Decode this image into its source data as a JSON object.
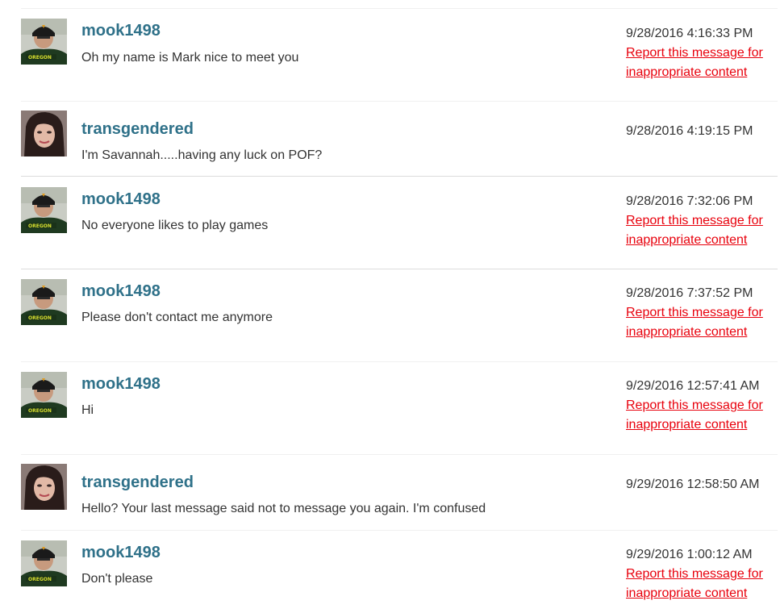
{
  "messages": [
    {
      "user": "mook1498",
      "avatar": "male-avatar",
      "text": "Oh my name is Mark nice to meet you",
      "time": "9/28/2016 4:16:33 PM",
      "report": "Report this message for inappropriate content"
    },
    {
      "user": "transgendered",
      "avatar": "female-avatar",
      "text": "I'm Savannah.....having any luck on POF?",
      "time": "9/28/2016 4:19:15 PM",
      "report": null
    },
    {
      "user": "mook1498",
      "avatar": "male-avatar",
      "text": "No everyone likes to play games",
      "time": "9/28/2016 7:32:06 PM",
      "report": "Report this message for inappropriate content"
    },
    {
      "user": "mook1498",
      "avatar": "male-avatar",
      "text": "Please don't contact me anymore",
      "time": "9/28/2016 7:37:52 PM",
      "report": "Report this message for inappropriate content"
    },
    {
      "user": "mook1498",
      "avatar": "male-avatar",
      "text": "Hi",
      "time": "9/29/2016 12:57:41 AM",
      "report": "Report this message for inappropriate content"
    },
    {
      "user": "transgendered",
      "avatar": "female-avatar",
      "text": "Hello? Your last message said not to message you again. I'm confused",
      "time": "9/29/2016 12:58:50 AM",
      "report": null
    },
    {
      "user": "mook1498",
      "avatar": "male-avatar",
      "text": "Don't please",
      "time": "9/29/2016 1:00:12 AM",
      "report": "Report this message for inappropriate content"
    }
  ],
  "colors": {
    "username": "#2f7189",
    "report_link": "#e8000c",
    "text": "#333333",
    "divider": "#dcdcdc"
  }
}
